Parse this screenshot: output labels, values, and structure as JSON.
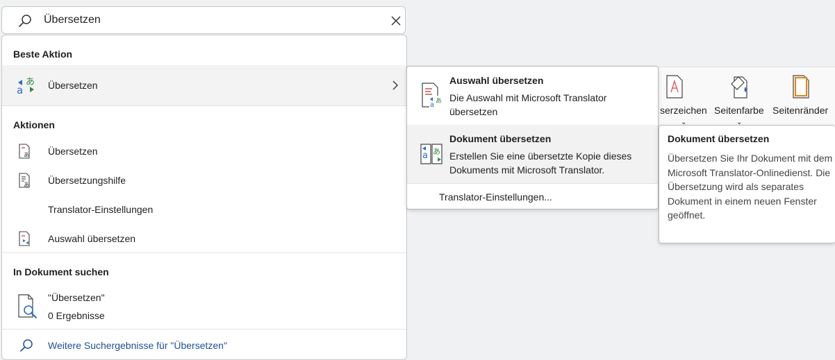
{
  "search": {
    "value": "Übersetzen",
    "icon": "search-icon",
    "clear_icon": "close-icon"
  },
  "best_action": {
    "heading": "Beste Aktion",
    "item": {
      "label": "Übersetzen",
      "icon": "translate-icon",
      "chevron": "chevron-right-icon"
    }
  },
  "actions": {
    "heading": "Aktionen",
    "items": [
      {
        "label": "Übersetzen",
        "icon": "translate-document-icon"
      },
      {
        "label": "Übersetzungshilfe",
        "icon": "translation-help-icon"
      },
      {
        "label": "Translator-Einstellungen",
        "icon": ""
      },
      {
        "label": "Auswahl übersetzen",
        "icon": "translate-selection-icon"
      }
    ]
  },
  "find_in_document": {
    "heading": "In Dokument suchen",
    "query": "\"Übersetzen\"",
    "result_count": "0 Ergebnisse",
    "icon": "document-search-icon"
  },
  "more_results": {
    "label": "Weitere Suchergebnisse für \"Übersetzen\"",
    "icon": "search-icon"
  },
  "submenu": {
    "items": [
      {
        "title": "Auswahl übersetzen",
        "description": "Die Auswahl mit Microsoft Translator übersetzen",
        "icon": "translate-selection-icon"
      },
      {
        "title": "Dokument übersetzen",
        "description": "Erstellen Sie eine übersetzte Kopie dieses Dokuments mit Microsoft Translator.",
        "icon": "translate-document-icon"
      }
    ],
    "settings_label": "Translator-Einstellungen..."
  },
  "ribbon": {
    "items": [
      {
        "label": "serzeichen",
        "icon": "watermark-icon"
      },
      {
        "label": "Seitenfarbe",
        "icon": "page-color-icon"
      },
      {
        "label": "Seitenränder",
        "icon": "page-borders-icon"
      }
    ]
  },
  "tooltip": {
    "title": "Dokument übersetzen",
    "description": "Übersetzen Sie Ihr Dokument mit dem Microsoft Translator-Onlinedienst. Die Übersetzung wird als separates Dokument in einem neuen Fenster geöffnet."
  },
  "colors": {
    "accent_blue": "#1e4e9b",
    "translate_blue": "#2b6cc4",
    "translate_green": "#2e8b3e",
    "highlight": "#f2f2f2"
  }
}
